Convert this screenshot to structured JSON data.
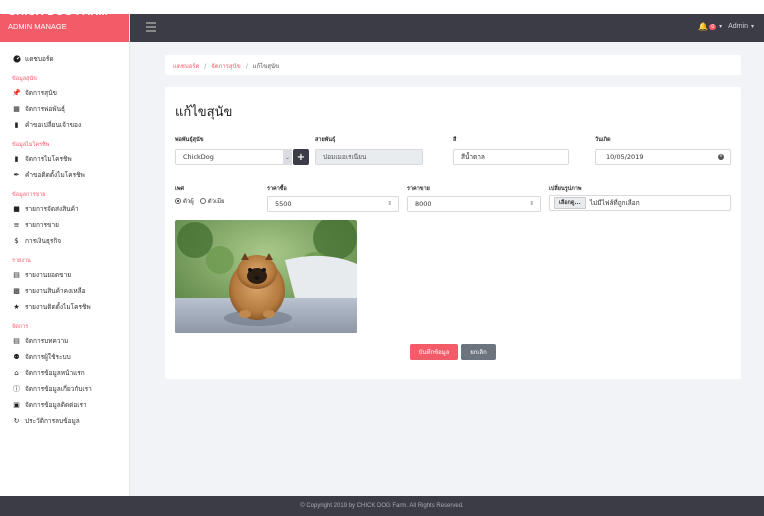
{
  "brand": {
    "title": "CHICK DOG FARM",
    "subtitle": "ADMIN MANAGE"
  },
  "topbar": {
    "badge_count": "0",
    "user": "Admin"
  },
  "sidebar": {
    "dashboard": "แดชบอร์ด",
    "sections": [
      {
        "title": "ข้อมูลสุนัข",
        "items": [
          {
            "label": "จัดการสุนัข",
            "icon": "thumbtack-icon"
          },
          {
            "label": "จัดการพ่อพันธุ์",
            "icon": "building-icon"
          },
          {
            "label": "คำขอเปลี่ยนเจ้าของ",
            "icon": "bookmark-icon"
          }
        ]
      },
      {
        "title": "ข้อมูลไมโครชิพ",
        "items": [
          {
            "label": "จัดการไมโครชิพ",
            "icon": "chip-icon"
          },
          {
            "label": "คำขอติดตั้งไมโครชิพ",
            "icon": "syringe-icon"
          }
        ]
      },
      {
        "title": "ข้อมูลการขาย",
        "items": [
          {
            "label": "รายการจัดส่งสินค้า",
            "icon": "truck-icon"
          },
          {
            "label": "รายการขาย",
            "icon": "list-icon"
          },
          {
            "label": "การเงินธุรกิจ",
            "icon": "dollar-icon"
          }
        ]
      },
      {
        "title": "รายงาน",
        "items": [
          {
            "label": "รายงานยอดขาย",
            "icon": "file-icon"
          },
          {
            "label": "รายงานสินค้าคงเหลือ",
            "icon": "boxes-icon"
          },
          {
            "label": "รายงานติดตั้งไมโครชิพ",
            "icon": "star-icon"
          }
        ]
      },
      {
        "title": "จัดการ",
        "items": [
          {
            "label": "จัดการบทความ",
            "icon": "newspaper-icon"
          },
          {
            "label": "จัดการผู้ใช้ระบบ",
            "icon": "users-icon"
          },
          {
            "label": "จัดการข้อมูลหน้าแรก",
            "icon": "home-icon"
          },
          {
            "label": "จัดการข้อมูลเกี่ยวกับเรา",
            "icon": "info-icon"
          },
          {
            "label": "จัดการข้อมูลติดต่อเรา",
            "icon": "contact-card-icon"
          },
          {
            "label": "ประวัติการลบข้อมูล",
            "icon": "history-icon"
          }
        ]
      }
    ]
  },
  "breadcrumb": {
    "home": "แดชบอร์ด",
    "parent": "จัดการสุนัข",
    "current": "แก้ไขสุนัข"
  },
  "form": {
    "title": "แก้ไขสุนัข",
    "breed_label": "พ่อพันธุ์สุนัข",
    "breed_value": "ChickDog",
    "species_label": "สายพันธุ์",
    "species_value": "ปอมเมอเรเนียน",
    "color_label": "สี",
    "color_value": "สีน้ำตาล",
    "birthdate_label": "วันเกิด",
    "birthdate_value": "10/05/2019",
    "sex_label": "เพศ",
    "sex_male": "ตัวผู้",
    "sex_female": "ตัวเมีย",
    "cost_label": "ราคาซื้อ",
    "cost_value": "5500",
    "price_label": "ราคาขาย",
    "price_value": "8000",
    "image_label": "เปลี่ยนรูปภาพ",
    "file_button": "เลือกดู...",
    "file_status": "ไม่มีไฟล์ที่ถูกเลือก",
    "save_button": "บันทึกข้อมูล",
    "cancel_button": "ยกเลิก"
  },
  "footer": "© Copyright 2019 by CHICK DOG Farm. All Rights Reserved.",
  "colors": {
    "accent": "#f45b69",
    "dark": "#3c3c46"
  }
}
